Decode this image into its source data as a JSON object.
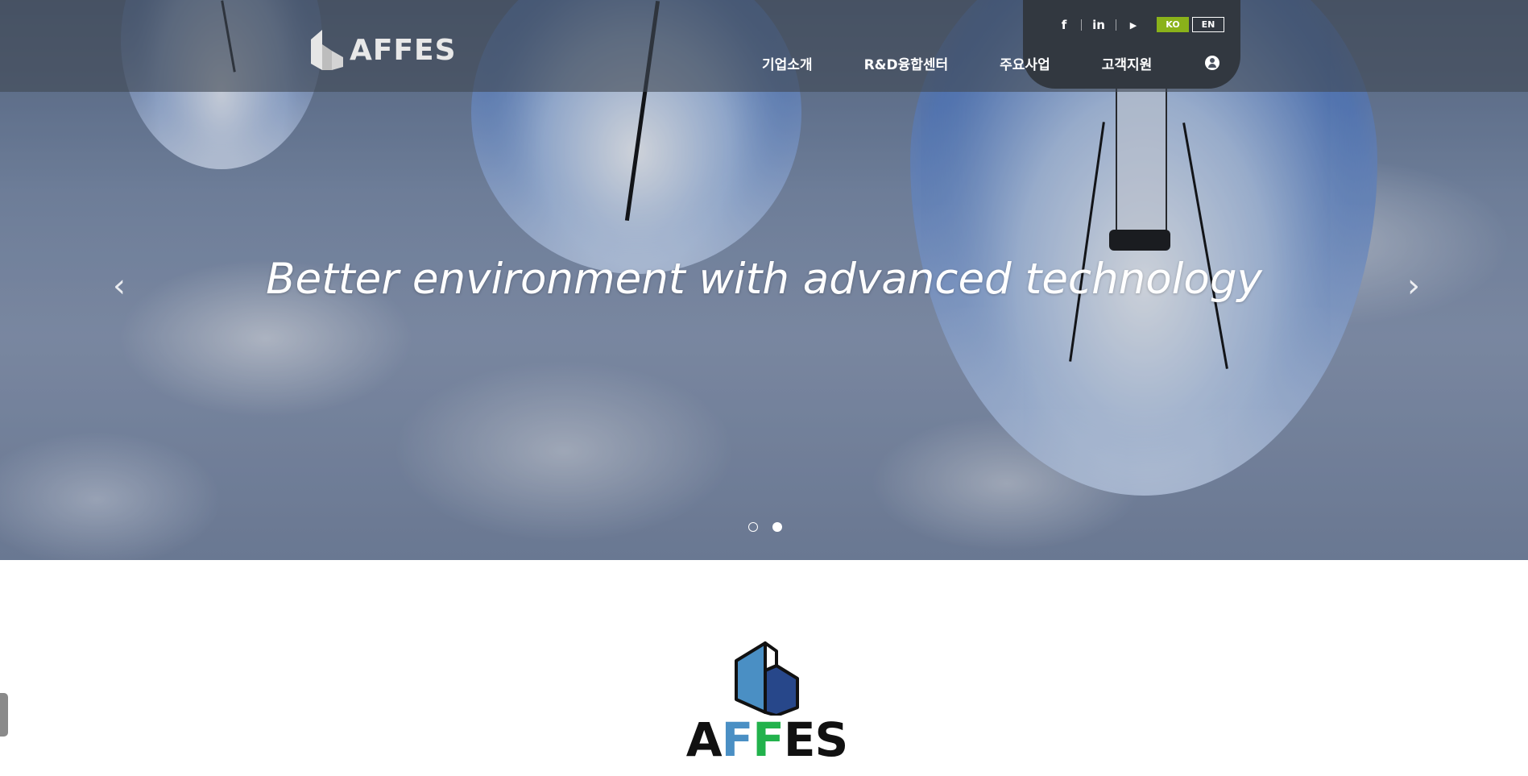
{
  "header": {
    "logo_text": "AFFES",
    "social": [
      {
        "icon": "facebook-icon",
        "glyph": "f"
      },
      {
        "icon": "linkedin-icon",
        "glyph": "in"
      },
      {
        "icon": "youtube-icon",
        "glyph": "▶"
      }
    ],
    "lang": {
      "ko": "KO",
      "en": "EN"
    },
    "nav": [
      "기업소개",
      "R&D융합센터",
      "주요사업",
      "고객지원"
    ],
    "user_icon": "user-circle-icon"
  },
  "hero": {
    "headline": "Better environment with advanced technology",
    "prev_glyph": "‹",
    "next_glyph": "›",
    "slide_count": 2,
    "active_slide": 2
  },
  "brand": {
    "letters": [
      "A",
      "F",
      "F",
      "E",
      "S"
    ],
    "colors": {
      "dark": "#111111",
      "blue_f": "#4a8fc4",
      "green_f": "#22b24c",
      "mark_light": "#4a8fc4",
      "mark_dark": "#27478a",
      "lang_active": "#8ab21a"
    }
  }
}
